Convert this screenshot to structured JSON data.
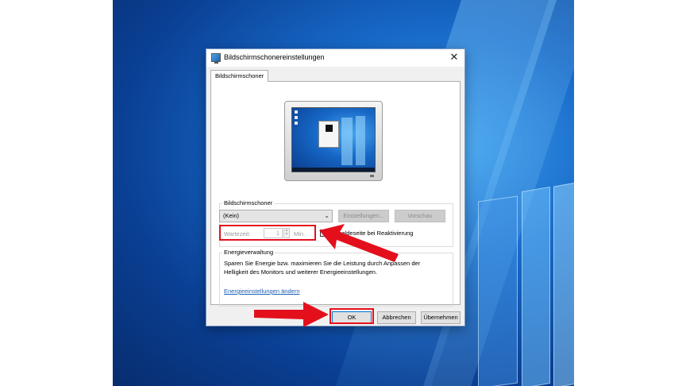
{
  "dialog": {
    "title": "Bildschirmschonereinstellungen",
    "close_glyph": "✕",
    "tab_label": "Bildschirmschoner"
  },
  "screensaver_group": {
    "legend": "Bildschirmschoner",
    "selected_value": "(Kein)",
    "settings_button": "Einstellungen...",
    "preview_button": "Vorschau",
    "wait_label": "Wartezeit:",
    "wait_value": "1",
    "wait_unit": "Min.",
    "logon_checkbox_label": "Anmeldeseite bei Reaktivierung",
    "logon_checked": false
  },
  "energy_group": {
    "legend": "Energieverwaltung",
    "description": "Sparen Sie Energie bzw. maximieren Sie die Leistung durch Anpassen der Helligkeit des Monitors und weiterer Energieeinstellungen.",
    "link_text": "Energieeinstellungen ändern"
  },
  "footer": {
    "ok_label": "OK",
    "cancel_label": "Abbrechen",
    "apply_label": "Übernehmen"
  },
  "colors": {
    "highlight": "#e3101c",
    "link": "#1a5fb4",
    "desktop_blue": "#1769c8"
  }
}
